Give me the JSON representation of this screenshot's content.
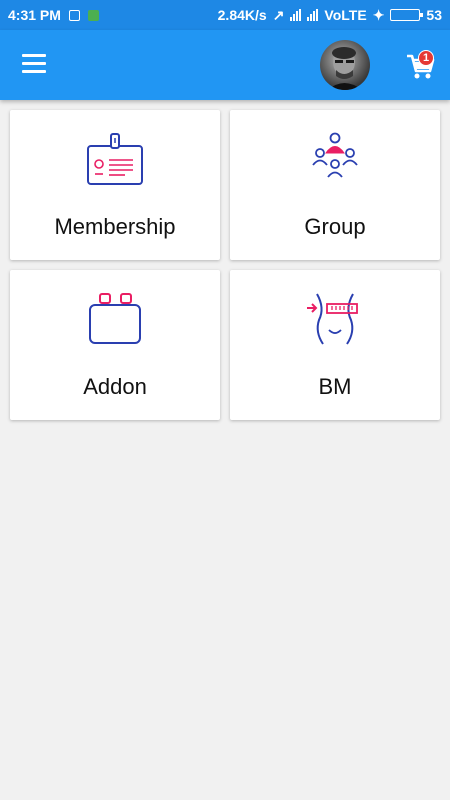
{
  "status_bar": {
    "time": "4:31 PM",
    "speed": "2.84K/s",
    "network": "VoLTE",
    "battery": "53"
  },
  "app_bar": {
    "cart_badge": "1"
  },
  "tiles": [
    {
      "label": "Membership",
      "icon": "id-badge-icon"
    },
    {
      "label": "Group",
      "icon": "group-icon"
    },
    {
      "label": "Addon",
      "icon": "addon-box-icon"
    },
    {
      "label": "BM",
      "icon": "body-measure-icon"
    }
  ],
  "colors": {
    "status_bar": "#1e88e5",
    "app_bar": "#2196f3",
    "icon_blue": "#2a3fb0",
    "icon_pink": "#e91e63",
    "badge": "#e53935"
  }
}
